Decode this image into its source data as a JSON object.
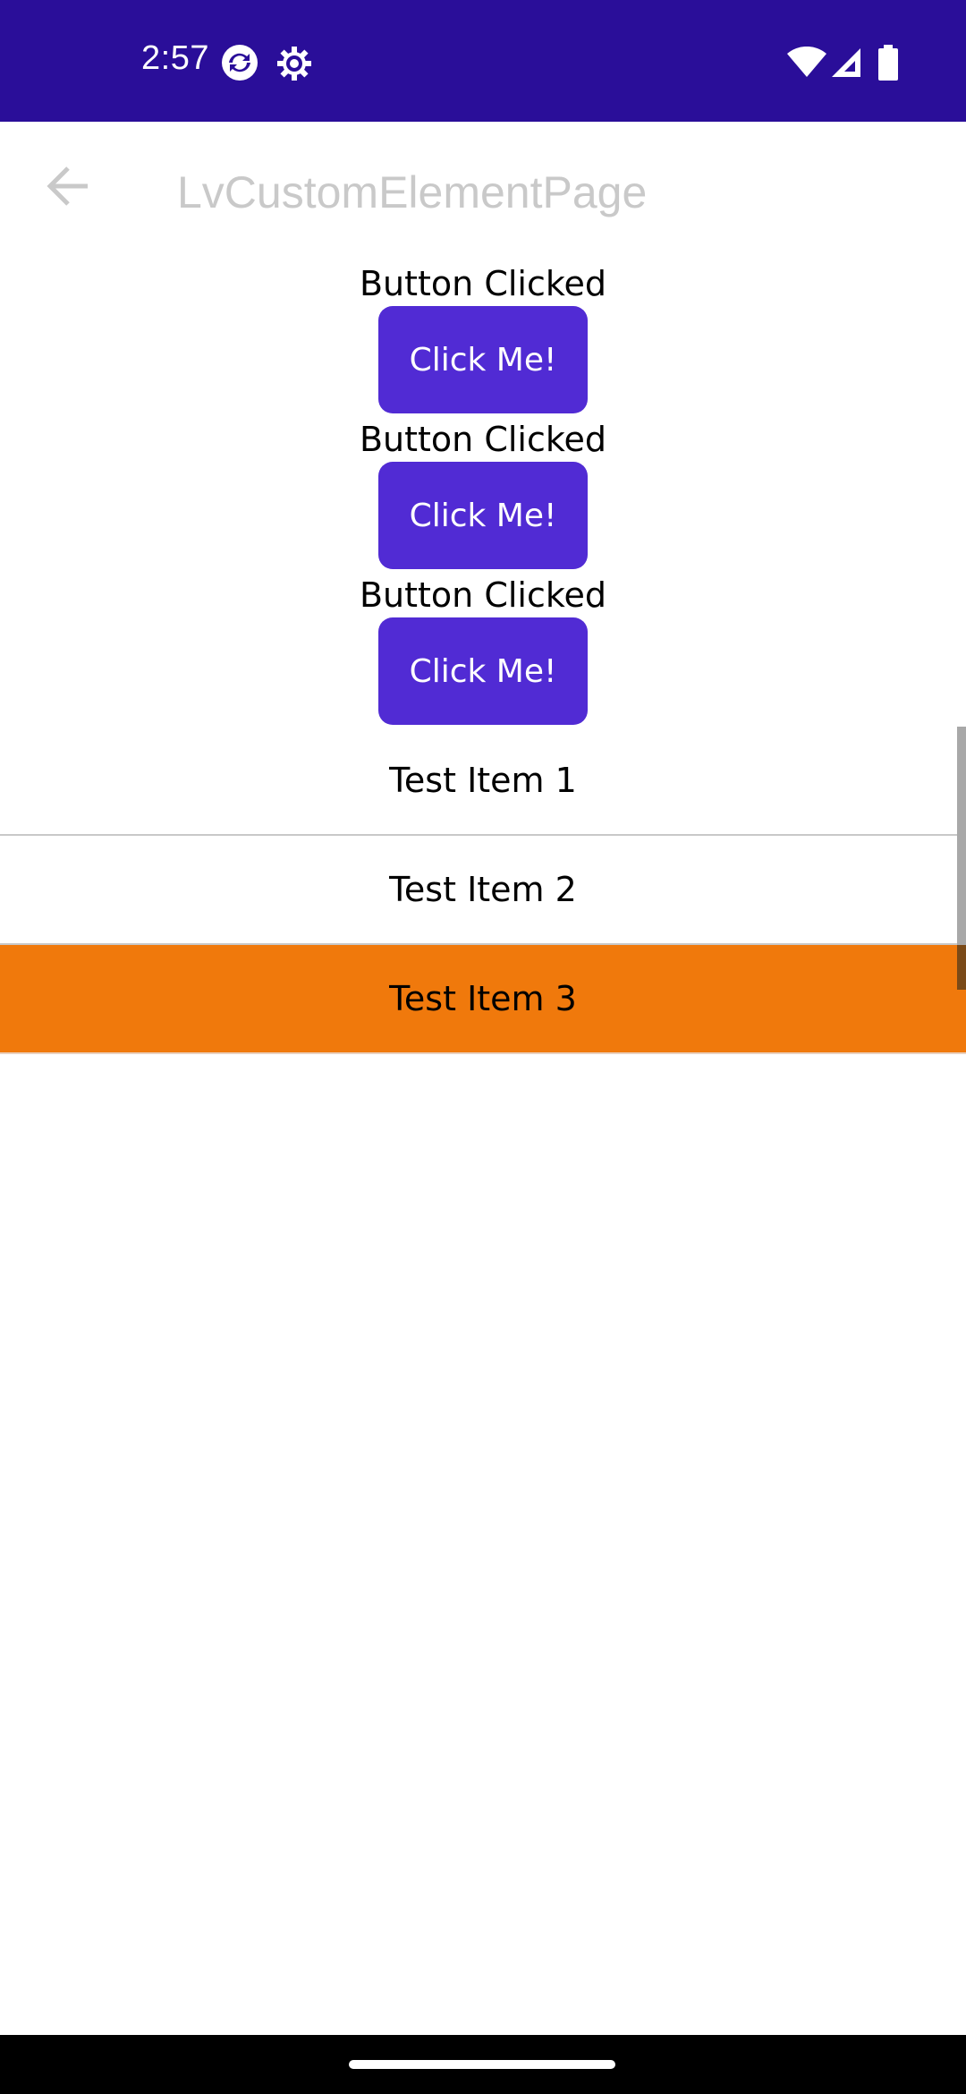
{
  "status_bar": {
    "time": "2:57",
    "background": "#2a0e99",
    "icons": [
      "sync-icon",
      "settings-gear-icon",
      "wifi-icon",
      "cellular-signal-icon",
      "battery-icon"
    ]
  },
  "app_bar": {
    "back_icon": "arrow-back-icon",
    "title": "LvCustomElementPage"
  },
  "custom_elements": [
    {
      "label": "Button Clicked",
      "button": "Click Me!"
    },
    {
      "label": "Button Clicked",
      "button": "Click Me!"
    },
    {
      "label": "Button Clicked",
      "button": "Click Me!"
    }
  ],
  "list": {
    "items": [
      {
        "label": "Test Item 1",
        "selected": false
      },
      {
        "label": "Test Item 2",
        "selected": false
      },
      {
        "label": "Test Item 3",
        "selected": true
      }
    ],
    "selected_color": "#f0790c"
  },
  "colors": {
    "accent": "#512bd4",
    "title_text": "#c9c9c9"
  }
}
